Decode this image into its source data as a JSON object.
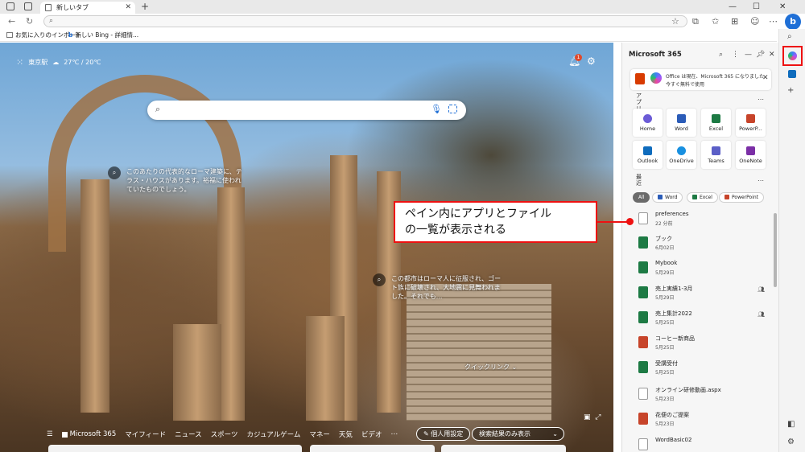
{
  "browser": {
    "tab_title": "新しいタブ",
    "tab_close": "✕",
    "new_tab": "+",
    "win_min": "—",
    "win_max": "☐",
    "win_close": "✕"
  },
  "bookmarks": [
    {
      "label": "お気に入りのインポート"
    },
    {
      "label": "新しい Bing - 詳細情..."
    }
  ],
  "newtab": {
    "location": "東京駅",
    "weather": "27℃ / 20℃",
    "notif_count": "1",
    "hotspot1_text": "このあたりの代表的なローマ建築に、テラス・ハウスがあります。裕福に使われていたものでしょう。",
    "hotspot2_text": "この都市はローマ人に征服され、ゴート族に破壊され、大地震に見舞われました。それでも...",
    "quick_links": "クイックリンク",
    "nav": [
      "Microsoft 365",
      "マイフィード",
      "ニュース",
      "スポーツ",
      "カジュアルゲーム",
      "マネー",
      "天気",
      "ビデオ"
    ],
    "personal_settings": "個人用設定",
    "results_only": "検索結果のみ表示"
  },
  "panel": {
    "title": "Microsoft 365",
    "banner_line1": "Office は現在、Microsoft 365 になりました",
    "banner_line2": "今すぐ無料で使用",
    "apps_label": "アプリ",
    "apps": [
      {
        "label": "Home",
        "color": "#6b5bd6"
      },
      {
        "label": "Word",
        "color": "#2b5cb8"
      },
      {
        "label": "Excel",
        "color": "#1d7a44"
      },
      {
        "label": "PowerP...",
        "color": "#c7442a"
      },
      {
        "label": "Outlook",
        "color": "#0f6cbd"
      },
      {
        "label": "OneDrive",
        "color": "#1890e0"
      },
      {
        "label": "Teams",
        "color": "#5b5fc7"
      },
      {
        "label": "OneNote",
        "color": "#7b2fa6"
      }
    ],
    "recent_label": "最近",
    "filters": [
      {
        "label": "All",
        "color": ""
      },
      {
        "label": "Word",
        "color": "#2b5cb8"
      },
      {
        "label": "Excel",
        "color": "#1d7a44"
      },
      {
        "label": "PowerPoint",
        "color": "#c7442a"
      }
    ],
    "files": [
      {
        "name": "preferences",
        "date": "22 分前",
        "type": "doc",
        "shared": false
      },
      {
        "name": "ブック",
        "date": "6月02日",
        "type": "xl",
        "shared": false
      },
      {
        "name": "Mybook",
        "date": "5月29日",
        "type": "xl",
        "shared": false
      },
      {
        "name": "売上実績1-3月",
        "date": "5月29日",
        "type": "xl",
        "shared": true
      },
      {
        "name": "売上集計2022",
        "date": "5月25日",
        "type": "xl",
        "shared": true
      },
      {
        "name": "コーヒー新商品",
        "date": "5月25日",
        "type": "pp",
        "shared": false
      },
      {
        "name": "受講受付",
        "date": "5月25日",
        "type": "xl",
        "shared": false
      },
      {
        "name": "オンライン研修動画.aspx",
        "date": "5月23日",
        "type": "doc",
        "shared": false
      },
      {
        "name": "花便のご提案",
        "date": "5月23日",
        "type": "pp",
        "shared": false
      },
      {
        "name": "WordBasic02",
        "date": "",
        "type": "doc",
        "shared": false
      }
    ]
  },
  "callout": {
    "line1": "ペイン内にアプリとファイル",
    "line2": "の一覧が表示される"
  }
}
